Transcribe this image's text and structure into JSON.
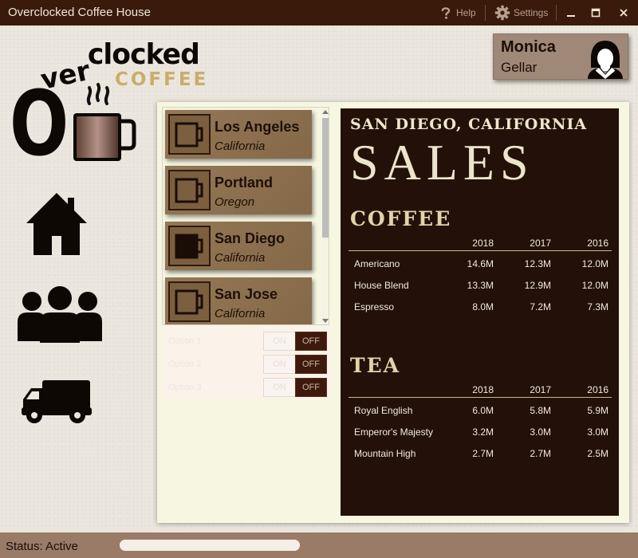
{
  "window": {
    "title": "Overclocked Coffee House",
    "help_label": "Help",
    "settings_label": "Settings"
  },
  "logo": {
    "line1": "clocked",
    "line2": "ver",
    "letter": "O",
    "line3": "COFFEE"
  },
  "nav": {
    "items": [
      {
        "icon": "home-icon"
      },
      {
        "icon": "users-icon"
      },
      {
        "icon": "truck-icon"
      }
    ]
  },
  "user": {
    "first_name": "Monica",
    "last_name": "Gellar"
  },
  "cities": [
    {
      "name": "Los Angeles",
      "state": "California",
      "selected": false
    },
    {
      "name": "Portland",
      "state": "Oregon",
      "selected": false
    },
    {
      "name": "San Diego",
      "state": "California",
      "selected": true
    },
    {
      "name": "San Jose",
      "state": "California",
      "selected": false
    }
  ],
  "options": [
    {
      "label": "Option 1",
      "on": "ON",
      "off": "OFF"
    },
    {
      "label": "Option 2",
      "on": "ON",
      "off": "OFF"
    },
    {
      "label": "Option 3",
      "on": "ON",
      "off": "OFF"
    }
  ],
  "board": {
    "city": "SAN DIEGO, CALIFORNIA",
    "heading": "SALES",
    "coffee": {
      "title": "COFFEE",
      "years": [
        "2018",
        "2017",
        "2016"
      ],
      "rows": [
        {
          "name": "Americano",
          "v": [
            "14.6M",
            "12.3M",
            "12.0M"
          ]
        },
        {
          "name": "House Blend",
          "v": [
            "13.3M",
            "12.9M",
            "12.0M"
          ]
        },
        {
          "name": "Espresso",
          "v": [
            "8.0M",
            "7.2M",
            "7.3M"
          ]
        }
      ]
    },
    "tea": {
      "title": "TEA",
      "years": [
        "2018",
        "2017",
        "2016"
      ],
      "rows": [
        {
          "name": "Royal English",
          "v": [
            "6.0M",
            "5.8M",
            "5.9M"
          ]
        },
        {
          "name": "Emperor's Majesty",
          "v": [
            "3.2M",
            "3.0M",
            "3.0M"
          ]
        },
        {
          "name": "Mountain High",
          "v": [
            "2.7M",
            "2.7M",
            "2.5M"
          ]
        }
      ]
    }
  },
  "status": {
    "text": "Status: Active"
  },
  "colors": {
    "titlebar": "#3a1a0b",
    "accent": "#a08878",
    "board": "#231109",
    "card": "#8d6f4c"
  }
}
